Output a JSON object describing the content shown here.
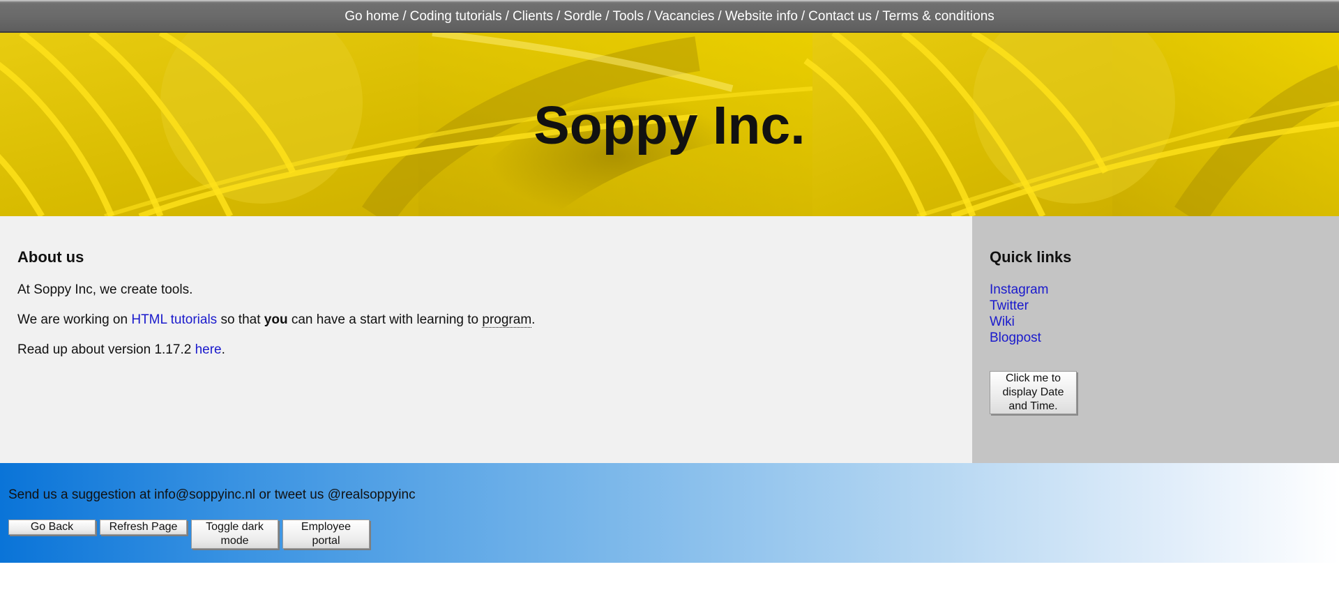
{
  "nav": {
    "items": [
      {
        "label": "Go home"
      },
      {
        "label": "Coding tutorials"
      },
      {
        "label": "Clients"
      },
      {
        "label": "Sordle"
      },
      {
        "label": "Tools"
      },
      {
        "label": "Vacancies"
      },
      {
        "label": "Website info"
      },
      {
        "label": "Contact us"
      },
      {
        "label": "Terms & conditions"
      }
    ],
    "separator": "/"
  },
  "banner": {
    "title": "Soppy Inc."
  },
  "about": {
    "heading": "About us",
    "line1": "At Soppy Inc, we create tools.",
    "line2_pre": "We are working on ",
    "line2_link": "HTML tutorials",
    "line2_mid": " so that ",
    "line2_bold": "you",
    "line2_mid2": " can have a start with learning to ",
    "line2_abbr": "program",
    "line2_end": ".",
    "line3_pre": "Read up about version 1.17.2 ",
    "line3_link": "here",
    "line3_end": "."
  },
  "quicklinks": {
    "heading": "Quick links",
    "links": [
      "Instagram",
      "Twitter",
      "Wiki",
      "Blogpost"
    ],
    "date_button": "Click me to display Date and Time."
  },
  "footer": {
    "suggestion": "Send us a suggestion at info@soppyinc.nl or tweet us @realsoppyinc",
    "buttons": [
      "Go Back",
      "Refresh Page",
      "Toggle dark mode",
      "Employee portal"
    ]
  },
  "colors": {
    "nav_bg": "#6a6a6a",
    "banner_yellow": "#e5c800",
    "main_bg": "#f1f1f1",
    "aside_bg": "#c4c4c4",
    "link": "#1a1acc",
    "footer_blue": "#0a74d8"
  }
}
